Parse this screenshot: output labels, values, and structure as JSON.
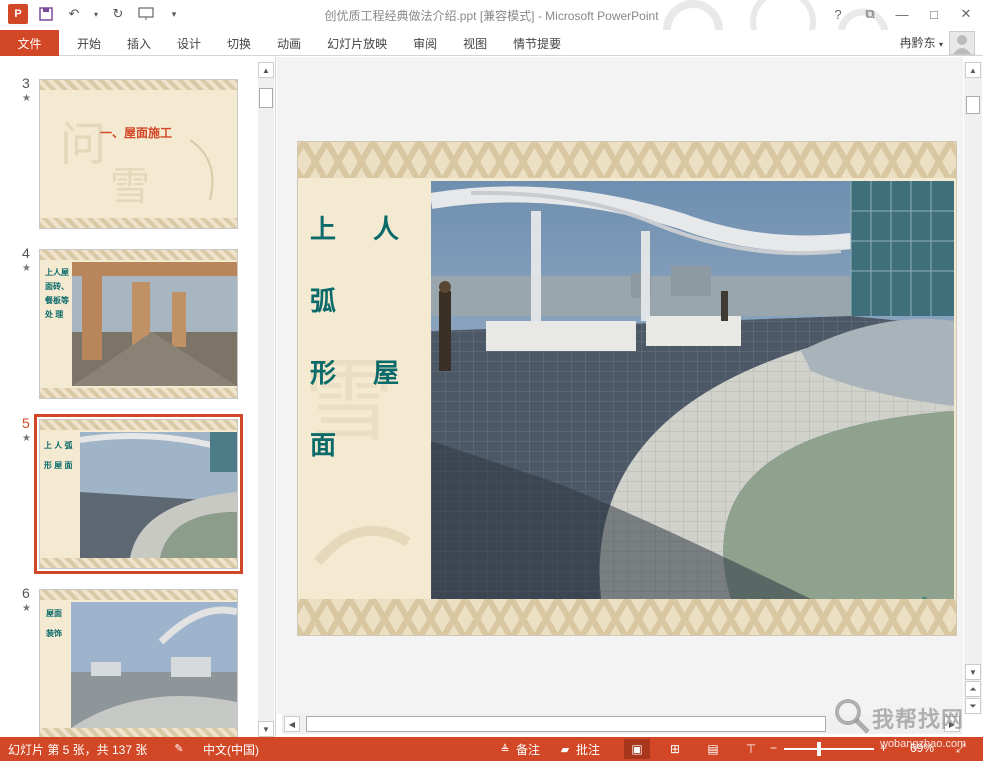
{
  "window": {
    "title": "创优质工程经典做法介绍.ppt [兼容模式] - Microsoft PowerPoint",
    "app_badge": "P",
    "help": "?",
    "restore": "⧉",
    "minimize": "—",
    "maximize": "□",
    "close": "✕"
  },
  "ribbon": {
    "file": "文件",
    "tabs": [
      "开始",
      "插入",
      "设计",
      "切换",
      "动画",
      "幻灯片放映",
      "审阅",
      "视图",
      "情节提要"
    ],
    "user": "冉黔东"
  },
  "thumbnails": [
    {
      "number": "3",
      "star": "★",
      "title": "一、屋面施工",
      "text": ""
    },
    {
      "number": "4",
      "star": "★",
      "title": "",
      "text": "上人屋\n面砖、\n餐板等\n处  理"
    },
    {
      "number": "5",
      "star": "★",
      "title": "",
      "text": "上  人  弧\n形 屋 面"
    },
    {
      "number": "6",
      "star": "★",
      "title": "",
      "text": "屋面\n装饰"
    }
  ],
  "slide": {
    "title_line1": "上 人 弧",
    "title_line2": "形 屋 面",
    "page_number": "5"
  },
  "status": {
    "slide_info": "幻灯片 第 5 张，共 137 张",
    "language": "中文(中国)",
    "notes": "备注",
    "comments": "批注",
    "zoom": "69%"
  },
  "watermark": {
    "text": "我帮找网",
    "url": "wobangzhao.com"
  },
  "colors": {
    "accent": "#d24726",
    "slide_bg": "#f4ead2",
    "slide_text": "#0a6a6a"
  }
}
